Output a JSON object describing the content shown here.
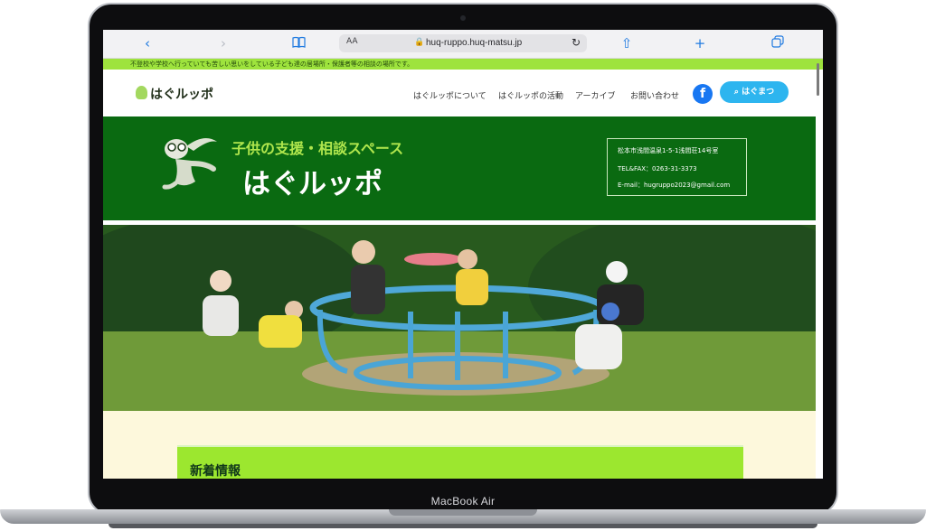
{
  "device": {
    "label": "MacBook Air"
  },
  "browser": {
    "text_size_label": "AA",
    "url": "huq-ruppo.huq-matsu.jp"
  },
  "site": {
    "announcement": "不登校や学校へ行っていても苦しい思いをしている子ども達の居場所・保護者等の相談の場所です。",
    "logo": "はぐルッポ",
    "nav_items": [
      "はぐルッポについて",
      "はぐルッポの活動",
      "アーカイブ",
      "お問い合わせ"
    ],
    "cta_label": "はぐまつ",
    "hero": {
      "subtitle": "子供の支援・相談スペース",
      "title": "はぐルッポ",
      "address": "松本市浅間温泉1-5-1浅間荘14号室",
      "tel_fax": "TEL&FAX：0263-31-3373",
      "email": "E-mail：hugruppo2023@gmail.com"
    },
    "news_title": "新着情報"
  },
  "icons": {
    "back": "chevron-left-icon",
    "forward": "chevron-right-icon",
    "bookmarks": "book-icon",
    "lock": "lock-icon",
    "reload": "reload-icon",
    "share": "share-icon",
    "new_tab": "plus-icon",
    "tabs": "tabs-icon",
    "facebook": "facebook-icon",
    "search": "search-icon"
  },
  "colors": {
    "browser_accent": "#1f7ae0",
    "banner": "#9ee33d",
    "hero_green": "#0a6a11",
    "cta_blue": "#2db5ef",
    "facebook_blue": "#1877f2",
    "content_bg": "#fdf8dc"
  }
}
